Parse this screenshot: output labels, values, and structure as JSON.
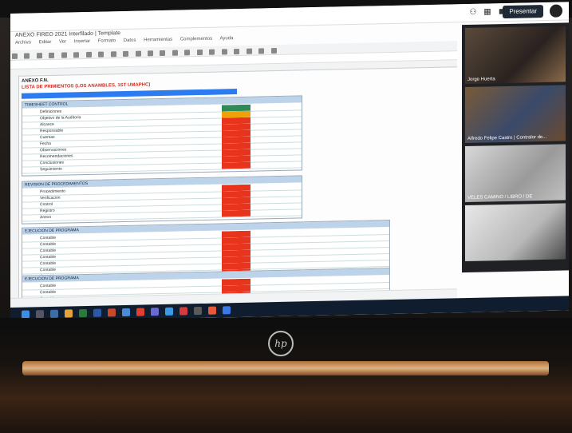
{
  "meet": {
    "present_label": "Presentar",
    "participants": [
      {
        "name": "Jorge Huerta"
      },
      {
        "name": "Alfredo Felipe Castro | Contralor de..."
      },
      {
        "name": "VELES CAMINO / LIBRO / DE"
      },
      {
        "name": ""
      }
    ]
  },
  "sheets": {
    "doc_title": "ANEXO FIREO 2021 Interfilado | Template",
    "menu": [
      "Archivo",
      "Editar",
      "Ver",
      "Insertar",
      "Formato",
      "Datos",
      "Herramientas",
      "Complementos",
      "Ayuda"
    ],
    "sheet_title": "ANEXO F.N.",
    "sheet_subtitle": "LISTA DE PRIMIENTOS (LOS ANAMBLES, 1ST UMAPHC)",
    "block1": {
      "header": "TIMESHEET CONTROL",
      "rows": [
        "Definiciones",
        "Objetivo de la Auditoria",
        "Alcance",
        "Responsable",
        "Cuentas",
        "Fecha",
        "Observaciones",
        "Recomendaciones",
        "Conclusiones",
        "Seguimiento"
      ]
    },
    "block2": {
      "header": "REVISION DE PROCEDIMIENTOS",
      "rows": [
        "Procedimiento",
        "Verificacion",
        "Control",
        "Registro",
        "Anexo"
      ]
    },
    "block3": {
      "header": "EJECUCION DE PROGRAMA",
      "rows": [
        "Contable",
        "Contable",
        "Contable",
        "Contable",
        "Contable",
        "Contable",
        "Contable"
      ]
    },
    "block4": {
      "header": "EJECUCION DE PROGRAMA",
      "rows": [
        "Contable",
        "Contable",
        "Contable",
        "Contable"
      ]
    }
  },
  "colors": {
    "accent_blue": "#2d7bf0",
    "status_red": "#e8341c",
    "status_green": "#2e8b57",
    "status_orange": "#f0a10a"
  },
  "laptop": {
    "brand": "hp"
  }
}
